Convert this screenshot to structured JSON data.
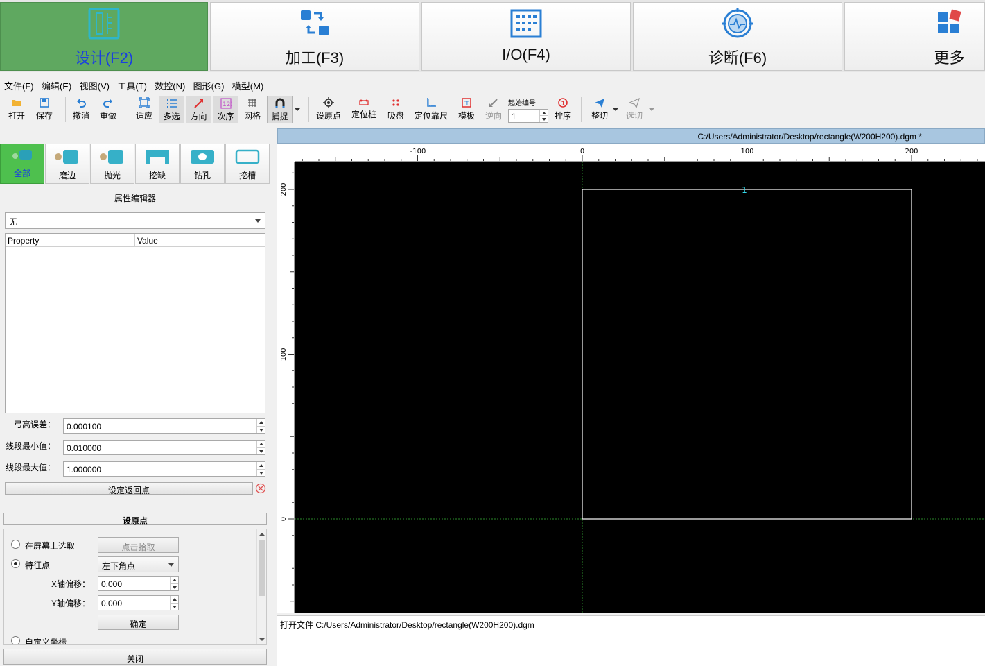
{
  "top_nav": {
    "items": [
      {
        "label": "设计(F2)",
        "icon": "design-ruler-icon"
      },
      {
        "label": "加工(F3)",
        "icon": "process-icon"
      },
      {
        "label": "I/O(F4)",
        "icon": "io-grid-icon"
      },
      {
        "label": "诊断(F6)",
        "icon": "diagnose-icon"
      },
      {
        "label": "更多",
        "icon": "more-apps-icon"
      }
    ],
    "active_color": "#5fa860"
  },
  "menu": [
    "文件(F)",
    "编辑(E)",
    "视图(V)",
    "工具(T)",
    "数控(N)",
    "图形(G)",
    "模型(M)"
  ],
  "toolbar": {
    "open": "打开",
    "save": "保存",
    "undo": "撤消",
    "redo": "重做",
    "fit": "适应",
    "multi_select": "多选",
    "direction": "方向",
    "order": "次序",
    "grid": "网格",
    "snap": "捕捉",
    "set_origin": "设原点",
    "locate_post": "定位桩",
    "suction": "吸盘",
    "locate_ruler": "定位靠尺",
    "template": "模板",
    "reverse": "逆向",
    "start_number_label": "起始编号",
    "start_number": "1",
    "sort": "排序",
    "full_cut": "整切",
    "select_cut": "选切"
  },
  "categories": [
    "全部",
    "磨边",
    "抛光",
    "挖缺",
    "钻孔",
    "挖槽"
  ],
  "property_editor": {
    "title": "属性编辑器",
    "selector": "无",
    "col_property": "Property",
    "col_value": "Value",
    "arc_error_label": "弓高误差：",
    "arc_error": "0.000100",
    "seg_min_label": "线段最小值：",
    "seg_min": "0.010000",
    "seg_max_label": "线段最大值：",
    "seg_max": "1.000000",
    "set_return_button": "设定返回点"
  },
  "origin_panel": {
    "title": "设原点",
    "pick_on_screen": "在屏幕上选取",
    "click_pick": "点击拾取",
    "feature_point": "特征点",
    "feature_value": "左下角点",
    "x_offset_label": "X轴偏移：",
    "x_offset": "0.000",
    "y_offset_label": "Y轴偏移：",
    "y_offset": "0.000",
    "confirm": "确定",
    "custom_coord": "自定义坐标",
    "close": "关闭"
  },
  "document": {
    "title": "C:/Users/Administrator/Desktop/rectangle(W200H200).dgm *",
    "h_ruler_labels": [
      "-100",
      "0",
      "100",
      "200"
    ],
    "v_ruler_labels": [
      "200",
      "100",
      "0"
    ],
    "shape_label": "1",
    "status": "打开文件 C:/Users/Administrator/Desktop/rectangle(W200H200).dgm"
  }
}
